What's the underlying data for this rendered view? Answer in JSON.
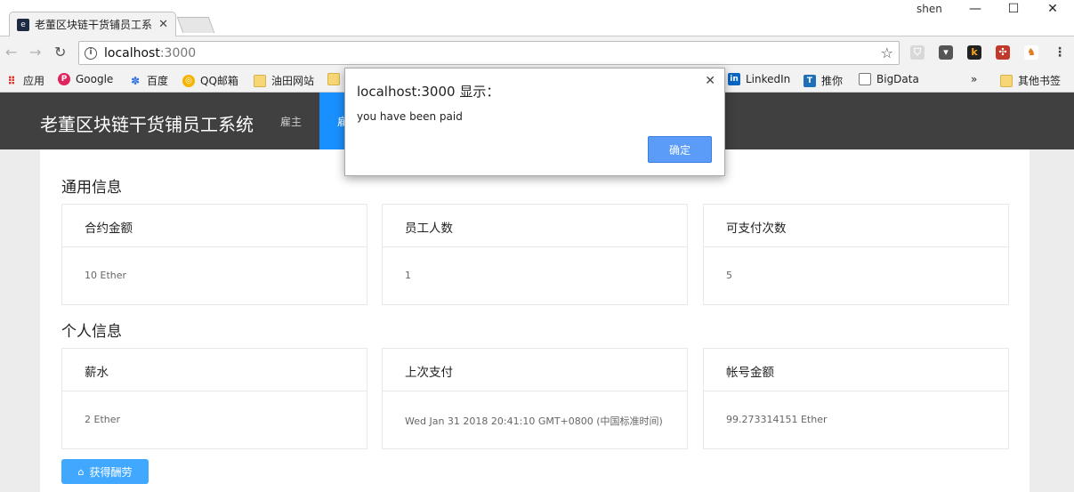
{
  "browser": {
    "tab_title": "老董区块链干货铺员工系",
    "user": "shen",
    "address_host": "localhost",
    "address_port": ":3000",
    "bookmarks": [
      {
        "label": "应用"
      },
      {
        "label": "Google"
      },
      {
        "label": "百度"
      },
      {
        "label": "QQ邮箱"
      },
      {
        "label": "油田网站"
      },
      {
        "label": "LinkedIn"
      },
      {
        "label": "推你"
      },
      {
        "label": "BigData"
      },
      {
        "label": "其他书签"
      }
    ],
    "overflow": "»"
  },
  "app": {
    "brand": "老董区块链干货铺员工系统",
    "nav": [
      {
        "label": "雇主"
      },
      {
        "label": "雇"
      }
    ]
  },
  "general": {
    "title": "通用信息",
    "cards": [
      {
        "label": "合约金额",
        "value": "10 Ether"
      },
      {
        "label": "员工人数",
        "value": "1"
      },
      {
        "label": "可支付次数",
        "value": "5"
      }
    ]
  },
  "personal": {
    "title": "个人信息",
    "cards": [
      {
        "label": "薪水",
        "value": "2 Ether"
      },
      {
        "label": "上次支付",
        "value": "Wed Jan 31 2018 20:41:10 GMT+0800 (中国标准时间)"
      },
      {
        "label": "帐号金额",
        "value": "99.273314151 Ether"
      }
    ]
  },
  "pay_button": {
    "label": "获得酬劳",
    "icon": "bank-icon"
  },
  "dialog": {
    "title": "localhost:3000 显示：",
    "message": "you have been paid",
    "ok_label": "确定"
  },
  "colors": {
    "nav_bg": "#404040",
    "accent": "#1890ff",
    "button": "#40a9ff"
  }
}
